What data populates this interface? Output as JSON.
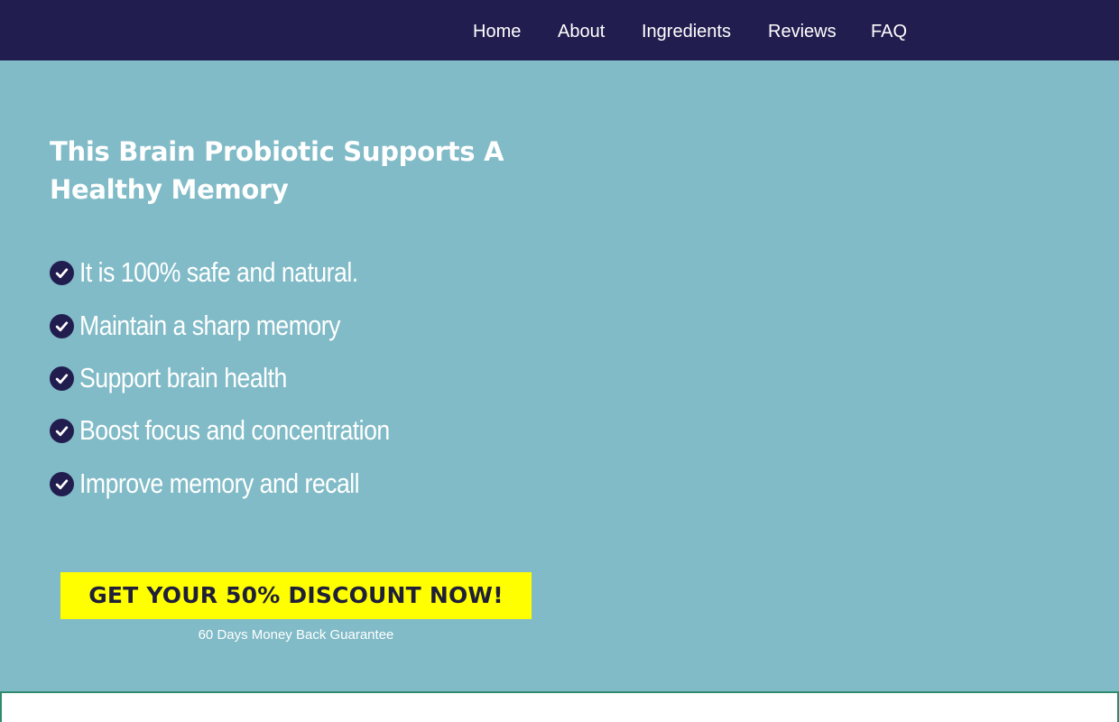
{
  "nav": {
    "items": [
      {
        "label": "Home"
      },
      {
        "label": "About"
      },
      {
        "label": "Ingredients"
      },
      {
        "label": "Reviews"
      },
      {
        "label": "FAQ"
      }
    ]
  },
  "hero": {
    "title": "This Brain Probiotic Supports A Healthy Memory",
    "benefits": [
      "It is 100% safe and natural.",
      "Maintain a sharp memory",
      "Support brain health",
      "Boost focus and concentration",
      "Improve memory and recall"
    ],
    "cta_label": "GET YOUR 50% DISCOUNT NOW!",
    "guarantee": "60 Days Money Back Guarantee"
  },
  "colors": {
    "nav_bg": "#221d4f",
    "page_bg": "#80bbc7",
    "cta_bg": "#ffff00",
    "check_bg": "#221d4f",
    "bottom_border": "#2e8b6f"
  },
  "icons": {
    "benefit_icon": "check-circle-icon"
  }
}
